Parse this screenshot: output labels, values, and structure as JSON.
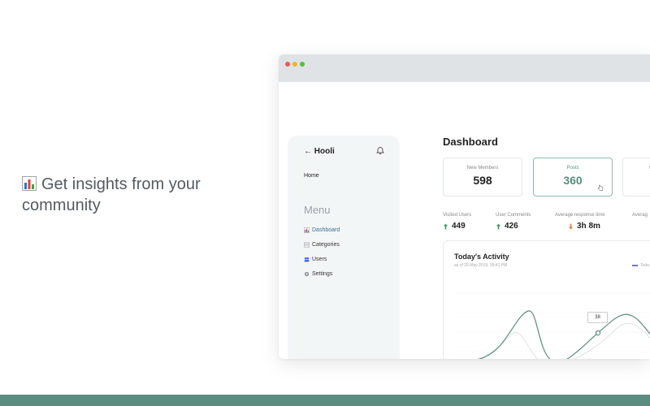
{
  "headline": {
    "line1": "Get insights from your",
    "line2": "community"
  },
  "sidebar": {
    "brand": "Hooli",
    "home": "Home",
    "menu_title": "Menu",
    "items": [
      {
        "label": "Dashboard",
        "icon": "bar-chart-icon"
      },
      {
        "label": "Categories",
        "icon": "categories-icon"
      },
      {
        "label": "Users",
        "icon": "users-icon"
      },
      {
        "label": "Settings",
        "icon": "gear-icon"
      }
    ]
  },
  "main": {
    "title": "Dashboard",
    "cards": [
      {
        "label": "New Members",
        "value": "598"
      },
      {
        "label": "Posts",
        "value": "360"
      },
      {
        "label": "C",
        "value": ""
      }
    ],
    "stats": [
      {
        "label": "Visited Users",
        "value": "449",
        "trend": "up"
      },
      {
        "label": "User Comments",
        "value": "426",
        "trend": "up"
      },
      {
        "label": "Average response time",
        "value": "3h 8m",
        "trend": "down"
      },
      {
        "label": "Averag",
        "value": "",
        "trend": ""
      }
    ],
    "activity": {
      "title": "Today's Activity",
      "subtitle": "as of 25 May 2019, 09:41 PM",
      "legend": "Toda",
      "tooltip": "38"
    }
  },
  "colors": {
    "accent": "#5b8c80",
    "up": "#3a9a5a",
    "down": "#e07a3a",
    "legend": "#6e78c8"
  }
}
